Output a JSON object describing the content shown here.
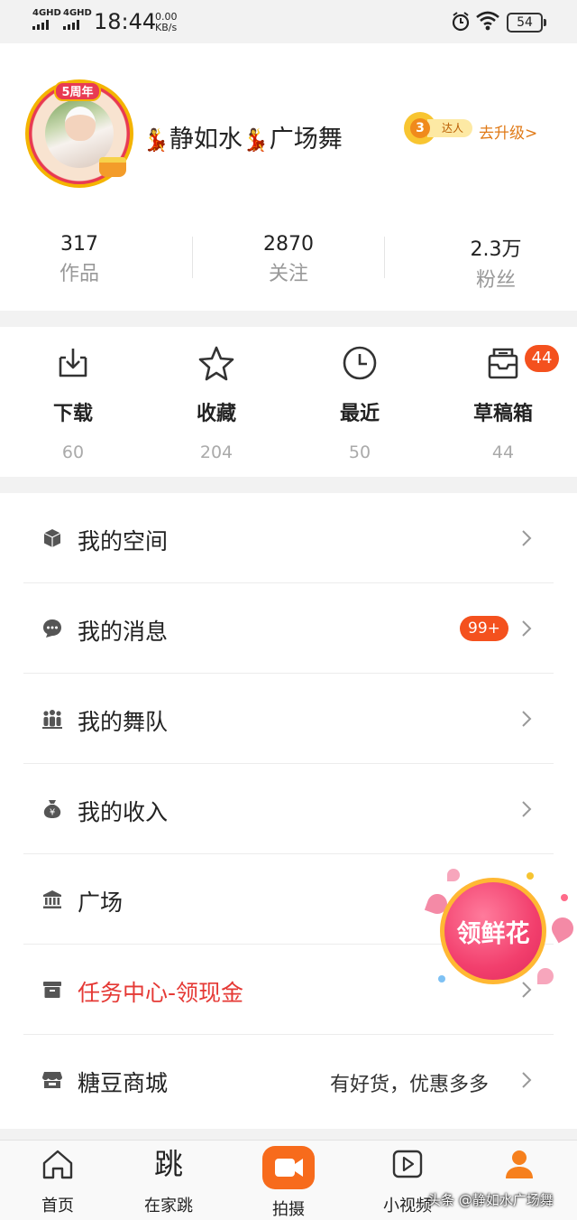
{
  "status_bar": {
    "network_1": "4GHD",
    "network_2": "4GHD",
    "time": "18:44",
    "speed_value": "0.00",
    "speed_unit": "KB/s",
    "battery": "54"
  },
  "profile": {
    "avatar_badge": "5周年",
    "username_prefix_icon": "dancer-emoji",
    "username": "静如水",
    "username_suffix": "广场舞",
    "level_number": "3",
    "level_title": "达人",
    "upgrade_label": "去升级>"
  },
  "stats": [
    {
      "value": "317",
      "label": "作品"
    },
    {
      "value": "2870",
      "label": "关注"
    },
    {
      "value": "2.3万",
      "label": "粉丝"
    }
  ],
  "quick_actions": [
    {
      "icon": "download-icon",
      "label": "下载",
      "count": "60"
    },
    {
      "icon": "star-icon",
      "label": "收藏",
      "count": "204"
    },
    {
      "icon": "clock-icon",
      "label": "最近",
      "count": "50"
    },
    {
      "icon": "drafts-icon",
      "label": "草稿箱",
      "count": "44",
      "badge": "44"
    }
  ],
  "menu": [
    {
      "icon": "cube-icon",
      "label": "我的空间"
    },
    {
      "icon": "chat-bubble-icon",
      "label": "我的消息",
      "badge": "99+"
    },
    {
      "icon": "team-icon",
      "label": "我的舞队"
    },
    {
      "icon": "money-bag-icon",
      "label": "我的收入"
    },
    {
      "icon": "bank-icon",
      "label": "广场"
    },
    {
      "icon": "task-box-icon",
      "label": "任务中心-领现金"
    },
    {
      "icon": "shop-icon",
      "label": "糖豆商城",
      "hint": "有好货，优惠多多"
    }
  ],
  "floating_button": {
    "label": "领鲜花"
  },
  "bottom_nav": [
    {
      "icon": "home-icon",
      "label": "首页"
    },
    {
      "icon": "tiao-glyph-icon",
      "glyph": "跳",
      "label": "在家跳"
    },
    {
      "icon": "camera-icon",
      "label": "拍摄"
    },
    {
      "icon": "play-icon",
      "label": "小视频"
    },
    {
      "icon": "profile-icon",
      "label": ""
    }
  ],
  "watermark": "头条 @静如水广场舞",
  "colors": {
    "accent": "#f76b1c",
    "badge": "#f4511e",
    "task_red": "#e53935",
    "profile_active": "#f6801d"
  }
}
